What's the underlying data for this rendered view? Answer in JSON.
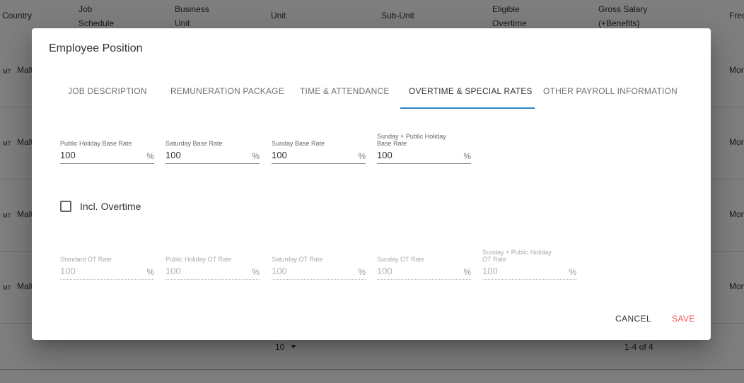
{
  "background_table": {
    "headers": {
      "country": "Country",
      "job_schedule_1": "Job",
      "job_schedule_2": "Schedule",
      "business_unit_1": "Business",
      "business_unit_2": "Unit",
      "unit": "Unit",
      "sub_unit": "Sub-Unit",
      "eligible_overtime_1": "Eligible",
      "eligible_overtime_2": "Overtime",
      "gross_salary_1": "Gross Salary",
      "gross_salary_2": "(+Benefits)",
      "frequency": "Freq"
    },
    "rows": [
      {
        "code": "MT",
        "country": "Malt",
        "frequency": "Mon"
      },
      {
        "code": "MT",
        "country": "Malt",
        "frequency": "Mon"
      },
      {
        "code": "MT",
        "country": "Malt",
        "frequency": "Mon"
      },
      {
        "code": "MT",
        "country": "Malt",
        "frequency": "Mon"
      }
    ],
    "footer": {
      "per_page": "10",
      "range": "1-4 of 4"
    }
  },
  "dialog": {
    "title": "Employee Position",
    "tabs": [
      {
        "label": "JOB DESCRIPTION",
        "active": false
      },
      {
        "label": "REMUNERATION PACKAGE",
        "active": false
      },
      {
        "label": "TIME & ATTENDANCE",
        "active": false
      },
      {
        "label": "OVERTIME & SPECIAL RATES",
        "active": true
      },
      {
        "label": "OTHER PAYROLL INFORMATION",
        "active": false
      }
    ],
    "base_rates": [
      {
        "label": "Public Holiday Base Rate",
        "value": "100",
        "unit": "%"
      },
      {
        "label": "Saturday Base Rate",
        "value": "100",
        "unit": "%"
      },
      {
        "label": "Sunday Base Rate",
        "value": "100",
        "unit": "%"
      },
      {
        "label": "Sunday + Public Holiday Base Rate",
        "value": "100",
        "unit": "%"
      }
    ],
    "incl_overtime": {
      "label": "Incl. Overtime",
      "checked": false
    },
    "ot_rates": [
      {
        "label": "Standard OT Rate",
        "value": "100",
        "unit": "%"
      },
      {
        "label": "Public Holiday OT Rate",
        "value": "100",
        "unit": "%"
      },
      {
        "label": "Saturday OT Rate",
        "value": "100",
        "unit": "%"
      },
      {
        "label": "Sunday OT Rate",
        "value": "100",
        "unit": "%"
      },
      {
        "label": "Sunday + Public Holiday OT Rate",
        "value": "100",
        "unit": "%"
      }
    ],
    "actions": {
      "cancel": "CANCEL",
      "save": "SAVE"
    },
    "colors": {
      "accent": "#2b86c5",
      "save": "#ec5a5a"
    }
  }
}
